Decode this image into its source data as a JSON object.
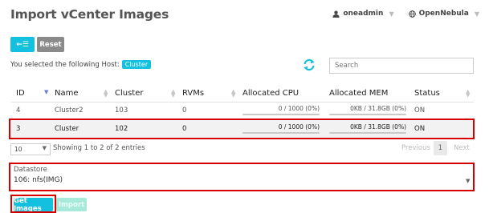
{
  "header": {
    "title": "Import vCenter Images",
    "user": "oneadmin",
    "zone": "OpenNebula"
  },
  "toolbar": {
    "back_label": "←☰",
    "reset_label": "Reset"
  },
  "selection": {
    "text": "You selected the following Host:",
    "host_tag": "Cluster"
  },
  "search": {
    "placeholder": "Search"
  },
  "table": {
    "columns": [
      "ID",
      "Name",
      "Cluster",
      "RVMs",
      "Allocated CPU",
      "Allocated MEM",
      "Status"
    ],
    "rows": [
      {
        "id": "4",
        "name": "Cluster2",
        "cluster": "103",
        "rvms": "0",
        "cpu": "0 / 1000 (0%)",
        "mem": "0KB / 31.8GB (0%)",
        "status": "ON"
      },
      {
        "id": "3",
        "name": "Cluster",
        "cluster": "102",
        "rvms": "0",
        "cpu": "0 / 1000 (0%)",
        "mem": "0KB / 31.8GB (0%)",
        "status": "ON"
      }
    ]
  },
  "footer": {
    "page_length": "10",
    "info": "Showing 1 to 2 of 2 entries",
    "previous": "Previous",
    "page": "1",
    "next": "Next"
  },
  "datastore": {
    "label": "Datastore",
    "value": "106: nfs(IMG)"
  },
  "actions": {
    "get_images": "Get Images",
    "import": "Import"
  },
  "colors": {
    "accent": "#13c0e0",
    "highlight": "#d60000"
  }
}
